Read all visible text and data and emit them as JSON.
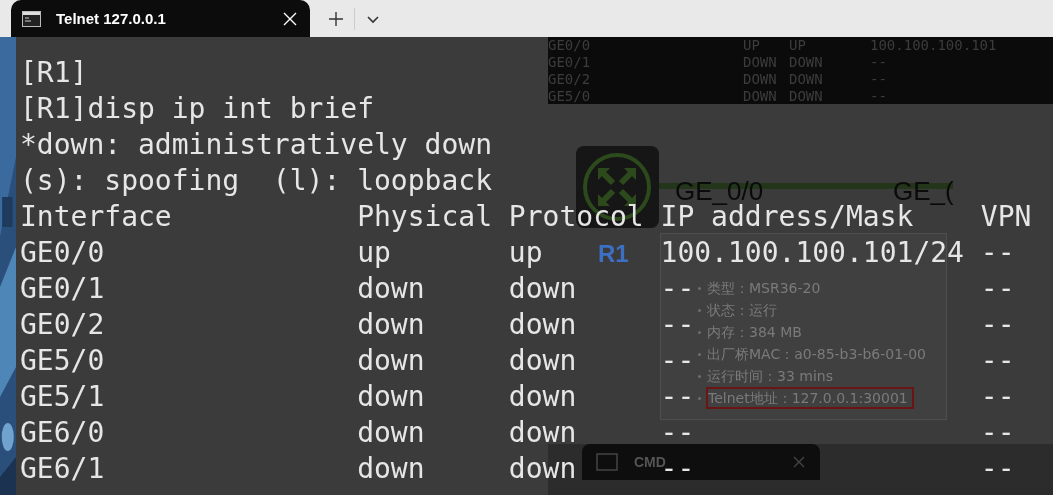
{
  "tab_bar": {
    "tabs": [
      {
        "title": "Telnet 127.0.0.1",
        "selected": true
      }
    ]
  },
  "terminal": {
    "lines": [
      "[R1]",
      "[R1]disp ip int brief",
      "*down: administratively down",
      "(s): spoofing  (l): loopback"
    ],
    "table": {
      "columns": [
        "Interface",
        "Physical",
        "Protocol",
        "IP address/Mask",
        "VPN"
      ],
      "rows": [
        [
          "GE0/0",
          "up",
          "up",
          "100.100.100.101/24",
          "--"
        ],
        [
          "GE0/1",
          "down",
          "down",
          "--",
          "--"
        ],
        [
          "GE0/2",
          "down",
          "down",
          "--",
          "--"
        ],
        [
          "GE5/0",
          "down",
          "down",
          "--",
          "--"
        ],
        [
          "GE5/1",
          "down",
          "down",
          "--",
          "--"
        ],
        [
          "GE6/0",
          "down",
          "down",
          "--",
          "--"
        ],
        [
          "GE6/1",
          "down",
          "down",
          "--",
          "--"
        ]
      ]
    }
  },
  "background": {
    "status_table": {
      "rows": [
        [
          "GE0/0",
          "UP",
          "UP",
          "100.100.100.101"
        ],
        [
          "GE0/1",
          "DOWN",
          "DOWN",
          "--"
        ],
        [
          "GE0/2",
          "DOWN",
          "DOWN",
          "--"
        ],
        [
          "GE5/0",
          "DOWN",
          "DOWN",
          "--"
        ]
      ]
    },
    "node": {
      "label": "R1"
    },
    "link": {
      "labels": [
        "GE_0/0",
        "GE_("
      ]
    },
    "tooltip": {
      "lines": [
        {
          "text": "类型：MSR36-20",
          "highlighted": false
        },
        {
          "text": "状态：运行",
          "highlighted": false
        },
        {
          "text": "内存：384 MB",
          "highlighted": false
        },
        {
          "text": "出厂桥MAC：a0-85-b3-b6-01-00",
          "highlighted": false
        },
        {
          "text": "运行时间：33 mins",
          "highlighted": false
        },
        {
          "text": "Telnet地址：127.0.0.1:30001",
          "highlighted": true
        }
      ]
    },
    "cmd_window": {
      "title": "CMD"
    }
  }
}
